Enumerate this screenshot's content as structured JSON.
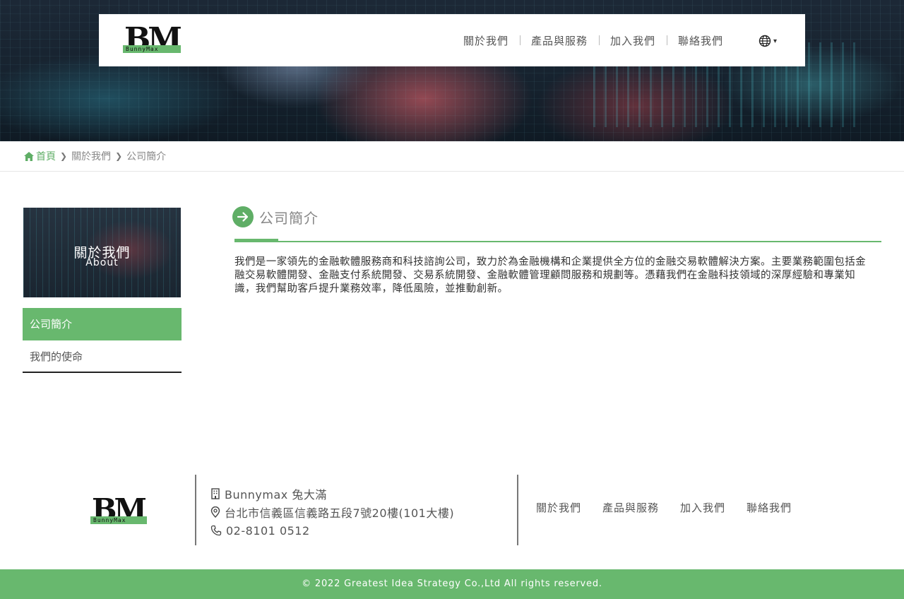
{
  "header": {
    "logo_text": "BM",
    "logo_tagline": "BunnyMax",
    "nav": [
      "關於我們",
      "產品與服務",
      "加入我們",
      "聯絡我們"
    ],
    "language_icon": "globe-icon",
    "language_caret": "▾"
  },
  "breadcrumb": {
    "home": "首頁",
    "items": [
      "關於我們",
      "公司簡介"
    ]
  },
  "sidebar": {
    "banner_title": "關於我們",
    "banner_subtitle": "About",
    "menu": [
      {
        "label": "公司簡介",
        "active": true
      },
      {
        "label": "我們的使命",
        "active": false
      }
    ]
  },
  "main": {
    "title": "公司簡介",
    "body": "我們是一家領先的金融軟體服務商和科技諮詢公司，致力於為金融機構和企業提供全方位的金融交易軟體解決方案。主要業務範圍包括金融交易軟體開發、金融支付系統開發、交易系統開發、金融軟體管理顧問服務和規劃等。憑藉我們在金融科技領域的深厚經驗和專業知識，我們幫助客戶提升業務效率，降低風險，並推動創新。"
  },
  "footer": {
    "company": "Bunnymax 兔大滿",
    "address": "台北市信義區信義路五段7號20樓(101大樓)",
    "phone": "02-8101 0512",
    "nav": [
      "關於我們",
      "產品與服務",
      "加入我們",
      "聯絡我們"
    ],
    "copyright": "© 2022 Greatest Idea Strategy Co.,Ltd All rights reserved."
  },
  "colors": {
    "accent": "#68b86e",
    "text": "#555555"
  }
}
